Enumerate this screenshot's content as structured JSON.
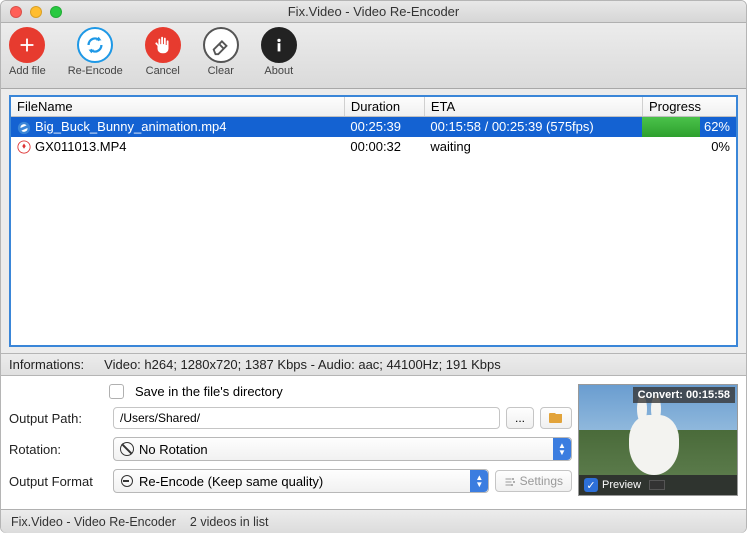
{
  "window": {
    "title": "Fix.Video - Video Re-Encoder"
  },
  "toolbar": {
    "add": "Add file",
    "reencode": "Re-Encode",
    "cancel": "Cancel",
    "clear": "Clear",
    "about": "About"
  },
  "columns": {
    "filename": "FileName",
    "duration": "Duration",
    "eta": "ETA",
    "progress": "Progress"
  },
  "files": [
    {
      "name": "Big_Buck_Bunny_animation.mp4",
      "duration": "00:25:39",
      "eta": "00:15:58 / 00:25:39 (575fps)",
      "progress": "62%",
      "progress_pct": 62,
      "selected": true
    },
    {
      "name": "GX011013.MP4",
      "duration": "00:00:32",
      "eta": "waiting",
      "progress": "0%",
      "progress_pct": 0,
      "selected": false
    }
  ],
  "info": {
    "label": "Informations:",
    "text": "Video: h264; 1280x720; 1387 Kbps - Audio: aac; 44100Hz; 191 Kbps"
  },
  "form": {
    "save_in_dir": "Save in the file's directory",
    "output_path_label": "Output Path:",
    "output_path": "/Users/Shared/",
    "rotation_label": "Rotation:",
    "rotation_value": "No Rotation",
    "format_label": "Output Format",
    "format_value": "Re-Encode (Keep same quality)",
    "browse": "...",
    "settings": "Settings"
  },
  "preview": {
    "header": "Convert: 00:15:58",
    "label": "Preview"
  },
  "status": {
    "app": "Fix.Video - Video Re-Encoder",
    "count": "2 videos in list"
  }
}
